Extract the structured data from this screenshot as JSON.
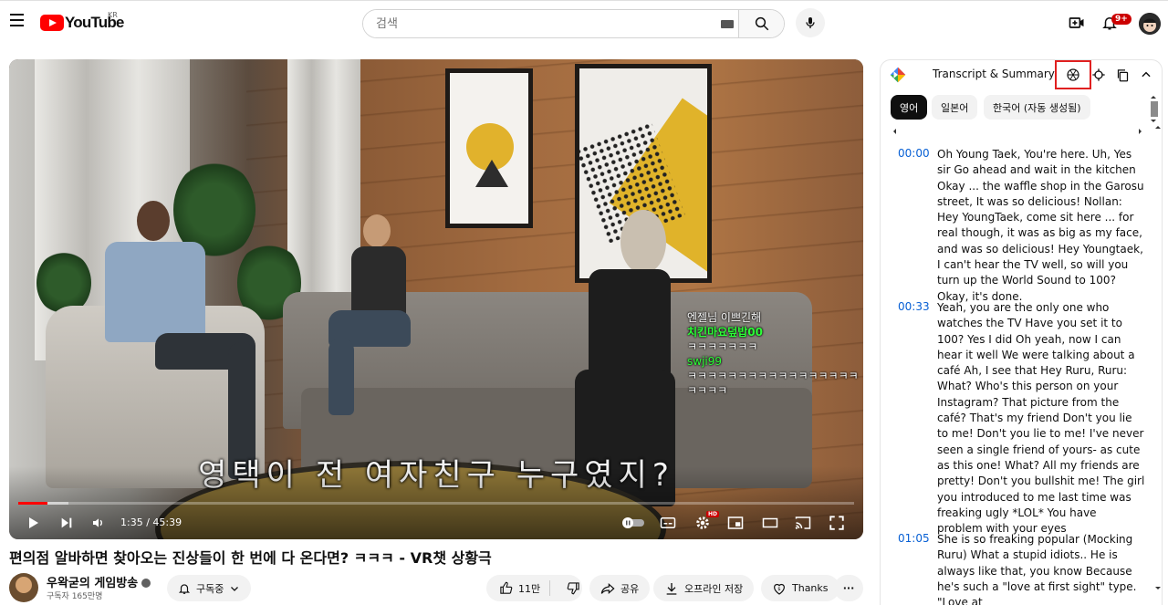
{
  "header": {
    "logo_text": "YouTube",
    "country_code": "KR",
    "search_placeholder": "검색",
    "notification_count": "9+"
  },
  "video": {
    "chat_overlay": [
      {
        "user": "엔젤님 이쁘긴해",
        "text": ""
      },
      {
        "user": "치킨마요덮밥00",
        "text": "ㅋㅋㅋㅋㅋㅋㅋ"
      },
      {
        "user": "swji99",
        "text": "ㅋㅋㅋㅋㅋㅋㅋㅋㅋㅋㅋㅋㅋㅋㅋㅋㅋㅋㅋㅋㅋ"
      }
    ],
    "subtitle": "영택이 전 여자친구 누구였지?",
    "time_display": "1:35 / 45:39",
    "progress_fraction": 0.035,
    "buffered_fraction": 0.06,
    "hd_badge": "HD"
  },
  "video_info": {
    "title": "편의점 알바하면 찾아오는 진상들이 한 번에 다 온다면? ㅋㅋㅋ - VR챗 상황극",
    "channel_name": "우왁굳의 게임방송",
    "subscribers": "구독자 165만명",
    "subscribe_label": "구독중",
    "like_count": "11만",
    "share_label": "공유",
    "download_label": "오프라인 저장",
    "thanks_label": "Thanks",
    "more_label": "···"
  },
  "panel": {
    "title": "Transcript & Summary",
    "languages": [
      {
        "label": "영어",
        "active": true
      },
      {
        "label": "일본어",
        "active": false
      },
      {
        "label": "한국어 (자동 생성됨)",
        "active": false
      }
    ],
    "segments": [
      {
        "time": "00:00",
        "text": "Oh Young Taek, You're here. Uh, Yes sir Go ahead and wait in the kitchen Okay ... the waffle shop in the Garosu street, It was so delicious! Nollan: Hey YoungTaek, come sit here ... for real though, it was as big as my face, and was so delicious! Hey Youngtaek, I can't hear the TV well, so will you turn up the World Sound to 100? Okay, it's done."
      },
      {
        "time": "00:33",
        "text": "Yeah, you are the only one who watches the TV Have you set it to 100? Yes I did Oh yeah, now I can hear it well We were talking about a café Ah, I see that Hey Ruru, Ruru: What? Who's this person on your Instagram? That picture from the café? That's my friend Don't you lie to me! Don't you lie to me! I've never seen a single friend of yours- as cute as this one! What? All my friends are pretty! Don't you bullshit me! The girl you introduced to me last time was freaking ugly *LOL* You have problem with your eyes"
      },
      {
        "time": "01:05",
        "text": "She is so freaking popular (Mocking Ruru) What a stupid idiots.. He is always like that, you know Because he's such a \"love at first sight\" type. \"Love at"
      }
    ]
  }
}
